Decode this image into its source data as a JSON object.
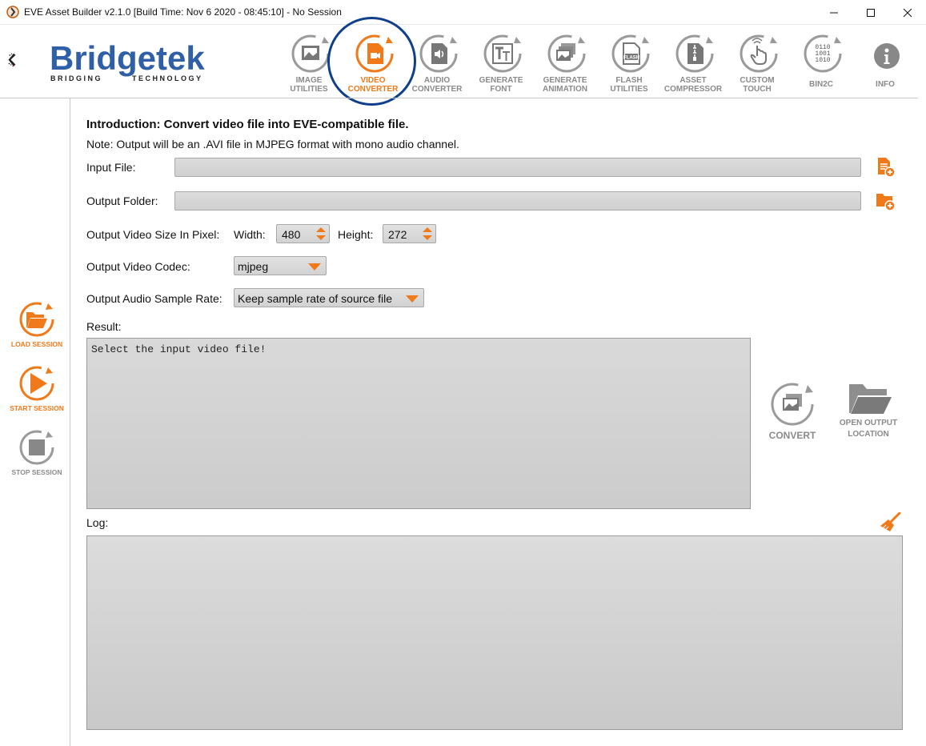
{
  "window": {
    "title": "EVE Asset Builder v2.1.0 [Build Time: Nov  6 2020 - 08:45:10] - No Session"
  },
  "logo": {
    "name": "Bridgetek",
    "tagline_left": "BRIDGING",
    "tagline_right": "TECHNOLOGY"
  },
  "toolbar": {
    "items": [
      {
        "line1": "IMAGE",
        "line2": "UTILITIES",
        "icon": "image-icon"
      },
      {
        "line1": "VIDEO",
        "line2": "CONVERTER",
        "icon": "video-icon",
        "active": true
      },
      {
        "line1": "AUDIO",
        "line2": "CONVERTER",
        "icon": "speaker-icon"
      },
      {
        "line1": "GENERATE",
        "line2": "FONT",
        "icon": "font-icon"
      },
      {
        "line1": "GENERATE",
        "line2": "ANIMATION",
        "icon": "animation-icon"
      },
      {
        "line1": "FLASH",
        "line2": "UTILITIES",
        "icon": "flash-icon"
      },
      {
        "line1": "ASSET",
        "line2": "COMPRESSOR",
        "icon": "zip-icon"
      },
      {
        "line1": "CUSTOM",
        "line2": "TOUCH",
        "icon": "touch-icon"
      },
      {
        "line1": "BIN2C",
        "line2": "",
        "icon": "binary-icon"
      },
      {
        "line1": "INFO",
        "line2": "",
        "icon": "info-icon"
      }
    ],
    "bin2c_glyph": [
      "0110",
      "1001",
      "1010"
    ],
    "flash_glyph": "FLASH"
  },
  "sidebar": {
    "load_session": "LOAD SESSION",
    "start_session": "START SESSION",
    "stop_session": "STOP SESSION"
  },
  "main": {
    "intro": "Introduction: Convert video file into EVE-compatible file.",
    "note": "Note: Output will be an .AVI file in MJPEG format with mono audio channel.",
    "input_file_label": "Input File:",
    "input_file_value": "",
    "output_folder_label": "Output Folder:",
    "output_folder_value": "",
    "video_size_label": "Output Video Size In Pixel:",
    "width_label": "Width:",
    "width_value": "480",
    "height_label": "Height:",
    "height_value": "272",
    "codec_label": "Output Video Codec:",
    "codec_value": "mjpeg",
    "sample_rate_label": "Output Audio Sample Rate:",
    "sample_rate_value": "Keep sample rate of source file",
    "result_label": "Result:",
    "result_text": "Select the input video file!",
    "log_label": "Log:",
    "log_text": "",
    "convert_label": "CONVERT",
    "open_output_line1": "OPEN OUTPUT",
    "open_output_line2": "LOCATION"
  },
  "colors": {
    "accent_orange": "#f07a1a",
    "brand_blue": "#2f5fa6",
    "active_ring": "#0f3f8a",
    "disabled_gray": "#8a8a8a"
  }
}
